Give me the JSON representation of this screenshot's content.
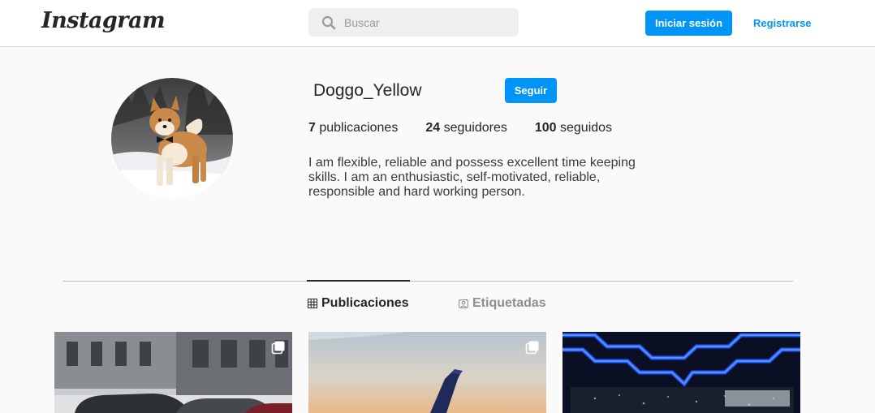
{
  "header": {
    "logo_text": "Instagram",
    "search": {
      "placeholder": "Buscar",
      "value": "",
      "icon": "search-icon"
    },
    "login_label": "Iniciar sesión",
    "register_label": "Registrarse"
  },
  "profile": {
    "username": "Doggo_Yellow",
    "follow_label": "Seguir",
    "stats": [
      {
        "count": "7",
        "label": "publicaciones"
      },
      {
        "count": "24",
        "label": "seguidores"
      },
      {
        "count": "100",
        "label": "seguidos"
      }
    ],
    "bio": "I am flexible, reliable and possess excellent time keeping skills. I am an enthusiastic, self-motivated, reliable, responsible and hard working person."
  },
  "tabs": [
    {
      "label": "Publicaciones",
      "icon": "grid-icon",
      "active": true
    },
    {
      "label": "Etiquetadas",
      "icon": "tagged-icon",
      "active": false
    }
  ],
  "colors": {
    "accent": "#0095f6",
    "background": "#fafafa",
    "text": "#262626",
    "muted": "#8e8e8e"
  }
}
